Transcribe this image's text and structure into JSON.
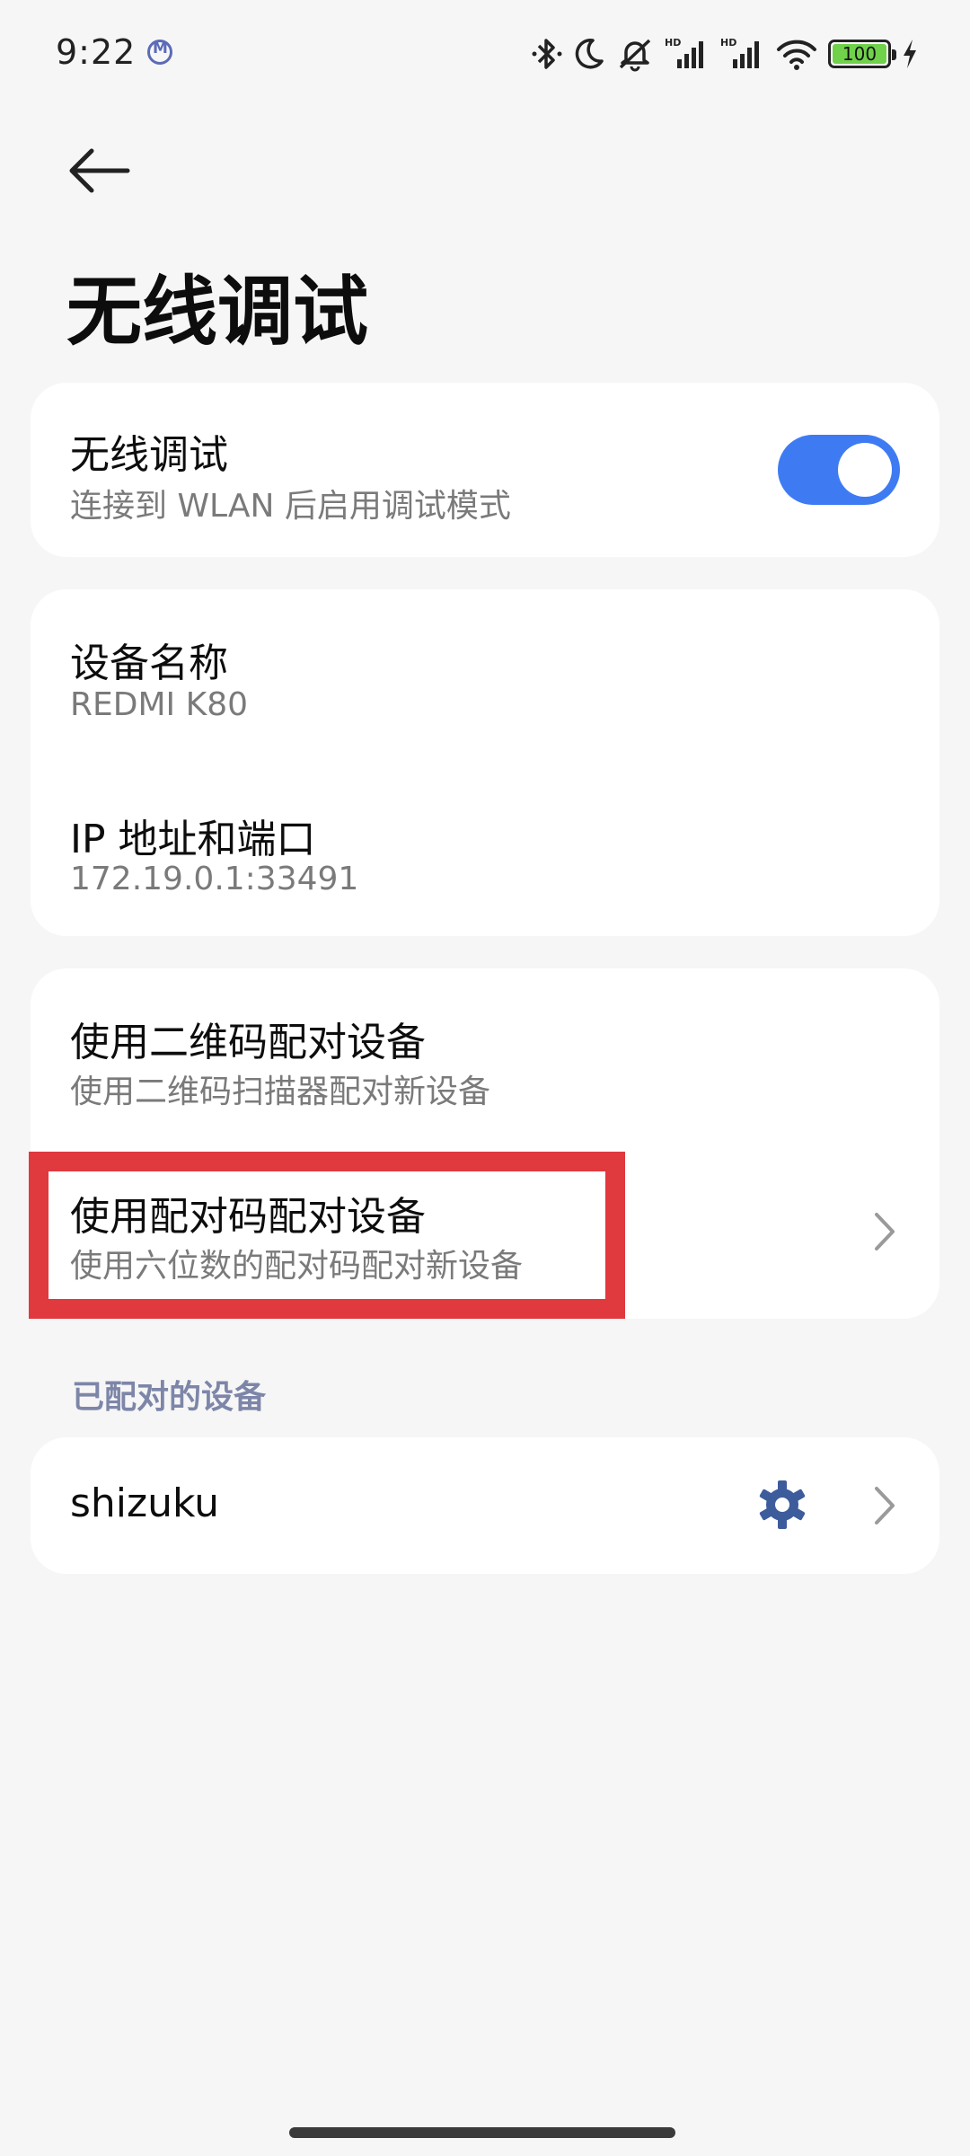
{
  "status_bar": {
    "time": "9:22",
    "notification_icon": "m-notification-icon",
    "icons": [
      "bluetooth-icon",
      "moon-icon",
      "silent-icon",
      "signal-hd-icon",
      "signal-hd-icon",
      "wifi-icon",
      "battery-icon",
      "charging-icon"
    ],
    "battery_percent": "100",
    "battery_level": 1.0,
    "battery_color": "#6fd24a"
  },
  "header": {
    "back_icon": "arrow-left-icon",
    "title": "无线调试"
  },
  "wireless_debug_card": {
    "title": "无线调试",
    "subtitle": "连接到 WLAN 后启用调试模式",
    "toggle_on": true,
    "toggle_color": "#3e7bf3"
  },
  "device_info_card": {
    "device_name_label": "设备名称",
    "device_name_value": "REDMI K80",
    "ip_label": "IP 地址和端口",
    "ip_value": "172.19.0.1:33491"
  },
  "pairing_card": {
    "qr_title": "使用二维码配对设备",
    "qr_subtitle": "使用二维码扫描器配对新设备",
    "code_title": "使用配对码配对设备",
    "code_subtitle": "使用六位数的配对码配对新设备",
    "chevron_icon": "chevron-right-icon"
  },
  "paired_section": {
    "header": "已配对的设备",
    "devices": [
      {
        "name": "shizuku",
        "settings_icon": "gear-icon",
        "chevron_icon": "chevron-right-icon"
      }
    ]
  },
  "annotation": {
    "highlight_color": "#e0393e"
  }
}
